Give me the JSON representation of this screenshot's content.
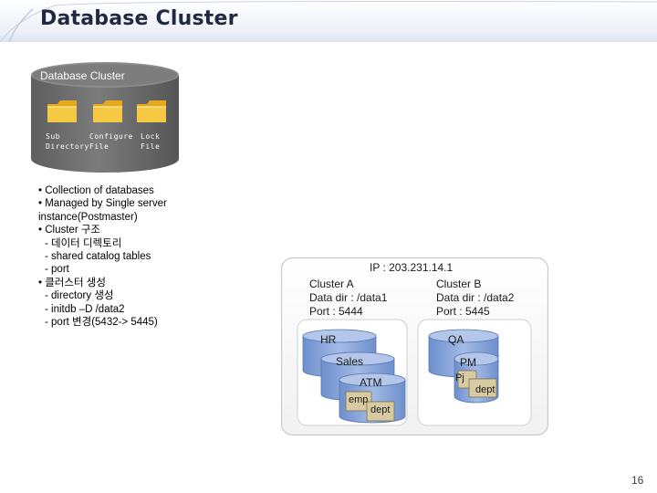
{
  "slide": {
    "title": "Database Cluster",
    "page_number": "16"
  },
  "cluster": {
    "label": "Database Cluster",
    "folders": [
      {
        "icon": "folder-icon",
        "label_line1": "Sub",
        "label_line2": "Directory"
      },
      {
        "icon": "folder-icon",
        "label_line1": "Configure",
        "label_line2": "File"
      },
      {
        "icon": "folder-icon",
        "label_line1": "Lock",
        "label_line2": "File"
      }
    ]
  },
  "bullets": {
    "l1": "• Collection of databases",
    "l2": "• Managed by Single server",
    "l3": "instance(Postmaster)",
    "l4": "• Cluster 구조",
    "l5": "- 데이터 디렉토리",
    "l6": "- shared catalog tables",
    "l7": "- port",
    "l8": "• 클러스터 생성",
    "l9": "- directory 생성",
    "l10": "- initdb –D /data2",
    "l11": "- port 변경(5432-> 5445)"
  },
  "diagram": {
    "ip": "IP : 203.231.14.1",
    "cluster_a": {
      "name": "Cluster  A",
      "data_dir": "Data dir : /data1",
      "port": "Port : 5444",
      "databases": [
        "HR",
        "Sales",
        "ATM"
      ],
      "tables": [
        "emp",
        "dept"
      ]
    },
    "cluster_b": {
      "name": "Cluster  B",
      "data_dir": "Data dir : /data2",
      "port": "Port : 5445",
      "databases": [
        "QA",
        "PM"
      ],
      "tables": [
        "Pj",
        "dept"
      ]
    }
  },
  "colors": {
    "cylinder": "#6f6f6f",
    "cylinder_top": "#8a8a8a",
    "folder": "#f4c542",
    "db_blue": "#7b9ad0",
    "table_tan": "#d8cba3"
  }
}
